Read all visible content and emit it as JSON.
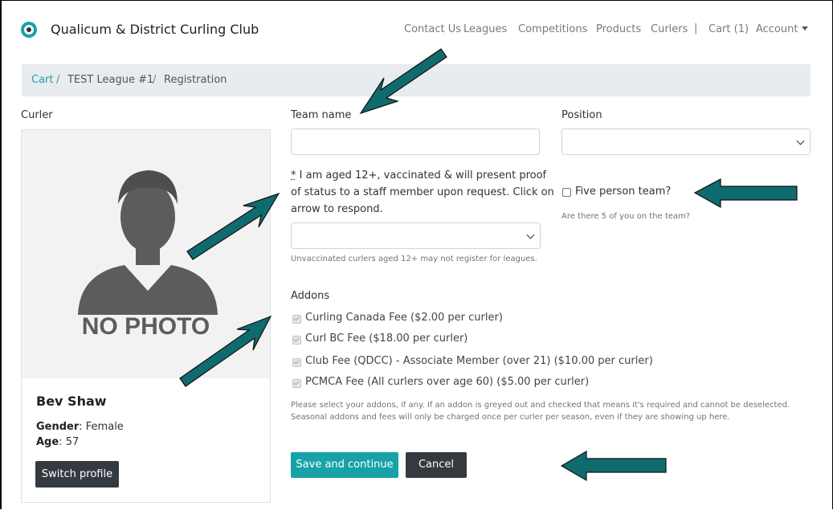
{
  "navbar": {
    "brand": "Qualicum & District Curling Club",
    "links": [
      "Contact Us",
      "Leagues",
      "Competitions",
      "Products",
      "Curlers"
    ],
    "separator": "|",
    "cart": "Cart (1)",
    "account": "Account"
  },
  "breadcrumb": {
    "cart": "Cart",
    "sep": "/",
    "league": "TEST League #1",
    "current": "Registration"
  },
  "curler": {
    "section_label": "Curler",
    "photo_text": "NO PHOTO",
    "name": "Bev Shaw",
    "gender_label": "Gender",
    "gender_value": ": Female",
    "age_label": "Age",
    "age_value": ": 57",
    "switch_button": "Switch profile"
  },
  "form": {
    "team_name_label": "Team name",
    "team_name_value": "",
    "position_label": "Position",
    "position_value": "",
    "vaccination_asterisk": "*",
    "vaccination_line1": " I am aged 12+, vaccinated & will present proof",
    "vaccination_line2": "of status to a staff member upon request. Click on",
    "vaccination_line3": "arrow to respond.",
    "vaccination_value": "",
    "vaccination_help": "Unvaccinated curlers aged 12+ may not register for leagues.",
    "five_person_label": "Five person team?",
    "five_person_help": "Are there 5 of you on the team?",
    "addons_label": "Addons",
    "addons": [
      {
        "label": "Curling Canada Fee ($2.00 per curler)",
        "checked": true,
        "disabled": true
      },
      {
        "label": "Curl BC Fee ($18.00 per curler)",
        "checked": true,
        "disabled": true
      },
      {
        "label": "Club Fee (QDCC) - Associate Member (over 21) ($10.00 per curler)",
        "checked": true,
        "disabled": true
      },
      {
        "label": "PCMCA Fee (All curlers over age 60) ($5.00 per curler)",
        "checked": true,
        "disabled": true
      }
    ],
    "addons_help_line1": "Please select your addons, if any. If an addon is greyed out and checked that means it's required and cannot be deselected.",
    "addons_help_line2": "Seasonal addons and fees will only be charged once per curler per season, even if they are showing up here.",
    "save_button": "Save and continue",
    "cancel_button": "Cancel"
  },
  "colors": {
    "accent": "#17a2a8",
    "dark_button": "#343a40",
    "annotation_arrow": "#0f6b6e",
    "breadcrumb_bg": "#e9ecef"
  }
}
